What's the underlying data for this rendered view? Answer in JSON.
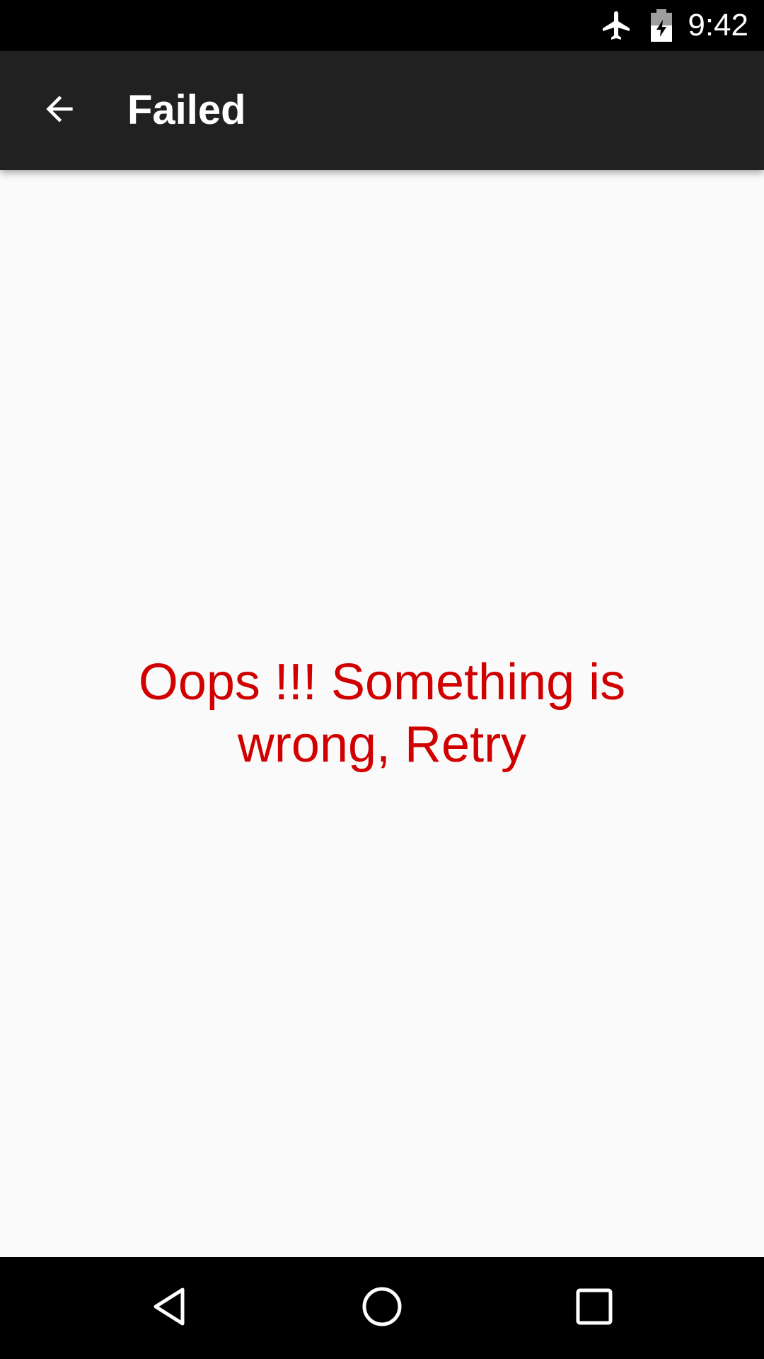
{
  "status_bar": {
    "time": "9:42",
    "icons": [
      "airplane-mode-icon",
      "battery-charging-icon"
    ]
  },
  "app_bar": {
    "title": "Failed",
    "back_icon": "arrow-back-icon"
  },
  "content": {
    "error_message": "Oops !!! Something is wrong, Retry"
  },
  "nav_bar": {
    "icons": [
      "nav-back-icon",
      "nav-home-icon",
      "nav-recents-icon"
    ]
  },
  "colors": {
    "status_bar_bg": "#000000",
    "app_bar_bg": "#212121",
    "content_bg": "#fafafa",
    "error_text": "#d00000",
    "nav_bar_bg": "#000000"
  }
}
